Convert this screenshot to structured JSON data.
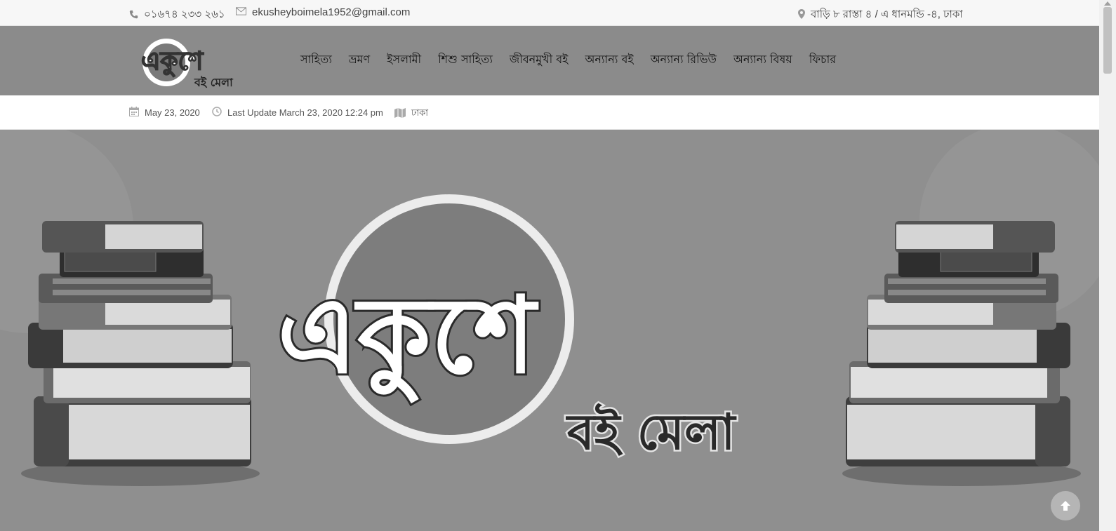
{
  "topbar": {
    "phone": "০১৬৭৪ ২৩৩ ২৬১",
    "email": "ekusheyboimela1952@gmail.com",
    "address": "বাড়ি ৮ রাস্তা ৪ / এ ধানমন্ডি -৪, ঢাকা",
    "icons": {
      "phone": "phone-icon",
      "email": "envelope-icon",
      "address": "map-marker-icon"
    }
  },
  "logo": {
    "line1": "একুশে",
    "line2": "বই মেলা"
  },
  "menu": {
    "items": [
      {
        "label": "সাহিত্য"
      },
      {
        "label": "ভ্রমণ"
      },
      {
        "label": "ইসলামী"
      },
      {
        "label": "শিশু সাহিত্য"
      },
      {
        "label": "জীবনমুখী বই"
      },
      {
        "label": "অন্যান্য বই"
      },
      {
        "label": "অন্যান্য রিভিউ"
      },
      {
        "label": "অন্যান্য বিষয়"
      },
      {
        "label": "ফিচার"
      }
    ]
  },
  "meta": {
    "date": "May 23, 2020",
    "last_update": "Last Update March 23, 2020 12:24 pm",
    "location": "ঢাকা",
    "icons": {
      "date": "calendar-icon",
      "update": "clock-icon",
      "location": "map-icon"
    }
  },
  "hero": {
    "title_line1": "একুশে",
    "title_line2": "বই মেলা",
    "background": "#8f8f8f"
  },
  "colors": {
    "header_bg": "#8b8b8b",
    "topbar_bg": "#f7f7f7"
  }
}
